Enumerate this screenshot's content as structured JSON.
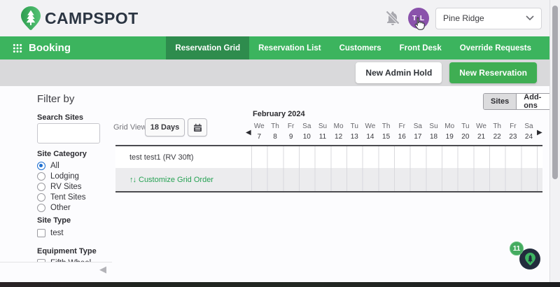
{
  "header": {
    "logo_text": "CAMPSPOT",
    "avatar_initials": "T L",
    "property_selector_value": "Pine Ridge"
  },
  "nav": {
    "app_label": "Booking",
    "tabs": [
      {
        "label": "Reservation Grid",
        "active": true
      },
      {
        "label": "Reservation List",
        "active": false
      },
      {
        "label": "Customers",
        "active": false
      },
      {
        "label": "Front Desk",
        "active": false
      },
      {
        "label": "Override Requests",
        "active": false
      }
    ]
  },
  "toolbar": {
    "new_admin_hold_label": "New Admin Hold",
    "new_reservation_label": "New Reservation"
  },
  "sidebar": {
    "title": "Filter by",
    "search": {
      "label": "Search Sites",
      "value": ""
    },
    "site_category": {
      "label": "Site Category",
      "options": [
        {
          "label": "All",
          "selected": true
        },
        {
          "label": "Lodging",
          "selected": false
        },
        {
          "label": "RV Sites",
          "selected": false
        },
        {
          "label": "Tent Sites",
          "selected": false
        },
        {
          "label": "Other",
          "selected": false
        }
      ]
    },
    "site_type": {
      "label": "Site Type",
      "options": [
        {
          "label": "test",
          "checked": false
        }
      ]
    },
    "equipment_type": {
      "label": "Equipment Type",
      "options": [
        {
          "label": "Fifth Wheel",
          "checked": false
        }
      ]
    }
  },
  "view_toggle": {
    "options": [
      {
        "label": "Sites",
        "selected": true
      },
      {
        "label": "Add-ons",
        "selected": false
      }
    ]
  },
  "grid": {
    "view_label": "Grid View:",
    "range_label": "18 Days",
    "month_label": "February 2024",
    "days": [
      {
        "dow": "We",
        "date": "7"
      },
      {
        "dow": "Th",
        "date": "8"
      },
      {
        "dow": "Fr",
        "date": "9"
      },
      {
        "dow": "Sa",
        "date": "10"
      },
      {
        "dow": "Su",
        "date": "11"
      },
      {
        "dow": "Mo",
        "date": "12"
      },
      {
        "dow": "Tu",
        "date": "13"
      },
      {
        "dow": "We",
        "date": "14"
      },
      {
        "dow": "Th",
        "date": "15"
      },
      {
        "dow": "Fr",
        "date": "16"
      },
      {
        "dow": "Sa",
        "date": "17"
      },
      {
        "dow": "Su",
        "date": "18"
      },
      {
        "dow": "Mo",
        "date": "19"
      },
      {
        "dow": "Tu",
        "date": "20"
      },
      {
        "dow": "We",
        "date": "21"
      },
      {
        "dow": "Th",
        "date": "22"
      },
      {
        "dow": "Fr",
        "date": "23"
      },
      {
        "dow": "Sa",
        "date": "24"
      }
    ],
    "rows": [
      {
        "label": "test test1 (RV 30ft)"
      }
    ],
    "customize_link_label": "Customize Grid Order",
    "sort_arrows_glyph": "↑↓",
    "prev_arrow_glyph": "◀",
    "next_arrow_glyph": "▶"
  },
  "chat": {
    "badge_count": "11"
  },
  "misc": {
    "collapse_arrow_glyph": "◀"
  },
  "colors": {
    "brand_green": "#3cb45e",
    "active_tab_green": "#2e8c4d",
    "button_green": "#3fae53",
    "link_green": "#27a254",
    "avatar_purple": "#8a52ab",
    "chat_navy": "#222c3d"
  }
}
